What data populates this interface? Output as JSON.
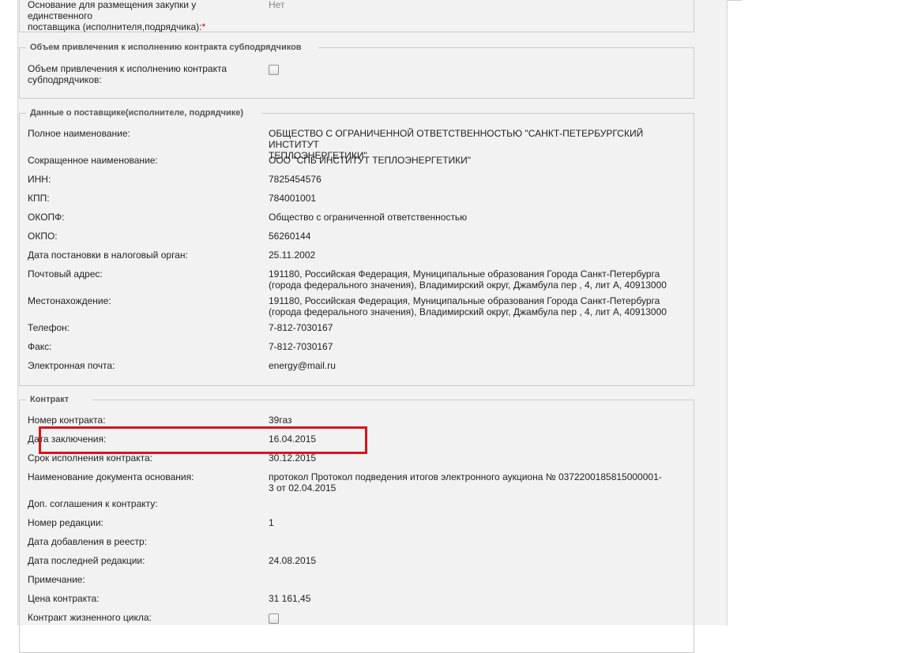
{
  "basis": {
    "label_line1": "Основание для размещения закупки у единственного",
    "label_line2": "поставщика (исполнителя,подрядчика):",
    "required_mark": "*",
    "value": "Нет"
  },
  "subcontractors": {
    "legend": "Объем привлечения к исполнению контракта субподрядчиков",
    "label_line1": "Объем привлечения к исполнению контракта",
    "label_line2": "субподрядчиков:",
    "checked": false
  },
  "supplier": {
    "legend": "Данные о поставщике(исполнителе, подрядчике)",
    "rows": [
      {
        "label": "Полное наименование:",
        "value": "ОБЩЕСТВО С ОГРАНИЧЕННОЙ ОТВЕТСТВЕННОСТЬЮ \"САНКТ-ПЕТЕРБУРГСКИЙ ИНСТИТУТ",
        "value2": "ТЕПЛОЭНЕРГЕТИКИ\""
      },
      {
        "label": "Сокращенное наименование:",
        "value": "ООО \"СПБ ИНСТИТУТ ТЕПЛОЭНЕРГЕТИКИ\""
      },
      {
        "label": "ИНН:",
        "value": "7825454576"
      },
      {
        "label": "КПП:",
        "value": "784001001"
      },
      {
        "label": "ОКОПФ:",
        "value": "Общество с ограниченной ответственностью"
      },
      {
        "label": "ОКПО:",
        "value": "56260144"
      },
      {
        "label": "Дата постановки в налоговый орган:",
        "value": "25.11.2002"
      },
      {
        "label": "Почтовый адрес:",
        "value": "191180, Российская Федерация, Муниципальные образования Города Санкт-Петербурга",
        "value2": "(города федерального значения), Владимирский округ, Джамбула пер , 4, лит А, 40913000"
      },
      {
        "label": "Местонахождение:",
        "value": "191180, Российская Федерация, Муниципальные образования Города Санкт-Петербурга",
        "value2": "(города федерального значения), Владимирский округ, Джамбула пер , 4, лит А, 40913000"
      },
      {
        "label": "Телефон:",
        "value": "7-812-7030167"
      },
      {
        "label": "Факс:",
        "value": "7-812-7030167"
      },
      {
        "label": "Электронная почта:",
        "value": "energy@mail.ru"
      }
    ]
  },
  "contract": {
    "legend": "Контракт",
    "rows": [
      {
        "label": "Номер контракта:",
        "value": "39газ"
      },
      {
        "label": "Дата заключения:",
        "value": "16.04.2015"
      },
      {
        "label": "Срок исполнения контракта:",
        "value": "30.12.2015"
      },
      {
        "label": "Наименование документа основания:",
        "value": "протокол Протокол подведения итогов электронного аукциона № 0372200185815000001-",
        "value2": "3 от 02.04.2015"
      },
      {
        "label": "Доп. соглашения к контракту:",
        "value": ""
      },
      {
        "label": "Номер редакции:",
        "value": "1"
      },
      {
        "label": "Дата добавления в реестр:",
        "value": ""
      },
      {
        "label": "Дата последней редакции:",
        "value": "24.08.2015"
      },
      {
        "label": "Примечание:",
        "value": ""
      },
      {
        "label": "Цена контракта:",
        "value": "31 161,45"
      },
      {
        "label": "Контракт жизненного цикла:",
        "value": "",
        "checkbox": true,
        "checked": false
      }
    ]
  },
  "highlight": {
    "target": "Дата заключения",
    "color": "#d8141b"
  }
}
